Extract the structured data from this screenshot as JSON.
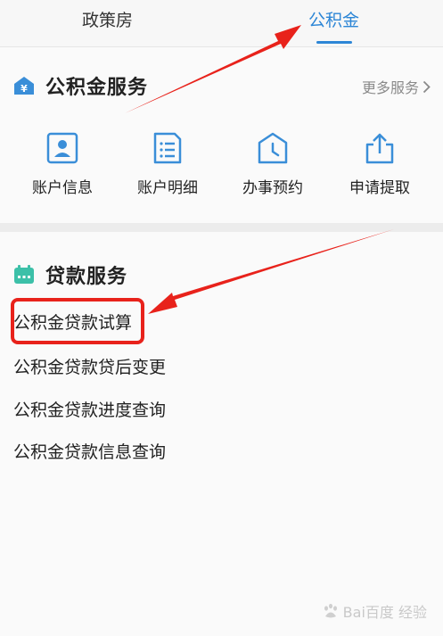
{
  "tabs": [
    {
      "label": "政策房",
      "active": false
    },
    {
      "label": "公积金",
      "active": true
    }
  ],
  "fund_section": {
    "title": "公积金服务",
    "title_icon_text": "¥",
    "more_label": "更多服务",
    "services": [
      {
        "label": "账户信息",
        "icon": "id-card-icon"
      },
      {
        "label": "账户明细",
        "icon": "list-document-icon"
      },
      {
        "label": "办事预约",
        "icon": "clock-house-icon"
      },
      {
        "label": "申请提取",
        "icon": "share-upload-icon"
      }
    ]
  },
  "loan_section": {
    "title": "贷款服务",
    "items": [
      {
        "label": "公积金贷款试算",
        "highlighted": true
      },
      {
        "label": "公积金贷款贷后变更",
        "highlighted": false
      },
      {
        "label": "公积金贷款进度查询",
        "highlighted": false
      },
      {
        "label": "公积金贷款信息查询",
        "highlighted": false
      }
    ]
  },
  "watermark": {
    "text": "Bai百度 经验"
  },
  "colors": {
    "accent": "#2d86d6",
    "annotation_red": "#e8221b",
    "icon_blue": "#3a8ed8",
    "calendar_teal": "#3cc0a8"
  }
}
